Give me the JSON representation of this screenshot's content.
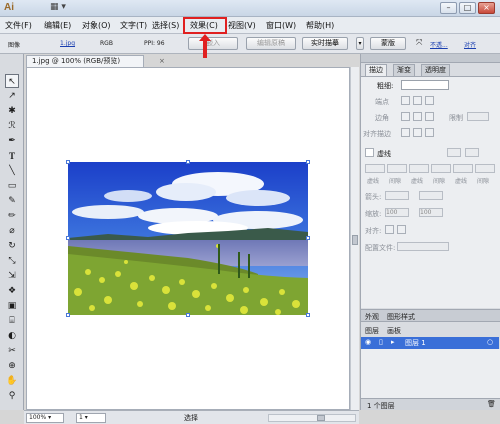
{
  "app": {
    "logo": "Ai",
    "arrange_icon": "▦ ▾"
  },
  "window_controls": [
    "–",
    "□",
    "×"
  ],
  "menu": [
    {
      "label": "文件(F)"
    },
    {
      "label": "编辑(E)"
    },
    {
      "label": "对象(O)"
    },
    {
      "label": "文字(T)"
    },
    {
      "label": "选择(S)"
    },
    {
      "label": "效果(C)"
    },
    {
      "label": "视图(V)"
    },
    {
      "label": "窗口(W)"
    },
    {
      "label": "帮助(H)"
    }
  ],
  "control_bar": {
    "object_type": "图像",
    "file_name": "1.jpg",
    "color_mode": "RGB",
    "ppi": "PPI: 96",
    "embed_button": "嵌入",
    "edit_original_button": "编辑原稿",
    "live_trace_button": "实时描摹",
    "mask_button": "蒙版",
    "opacity_link": "不透...",
    "align_link": "对齐"
  },
  "document": {
    "tab_title": "1.jpg @ 100% (RGB/预览)",
    "close": "×"
  },
  "status": {
    "zoom": "100%",
    "page": "1",
    "tool": "选择"
  },
  "tools": [
    {
      "glyph": "↖"
    },
    {
      "glyph": "↗"
    },
    {
      "glyph": "✱"
    },
    {
      "glyph": "ℛ"
    },
    {
      "glyph": "✒"
    },
    {
      "glyph": "T"
    },
    {
      "glyph": "╲"
    },
    {
      "glyph": "▭"
    },
    {
      "glyph": "✎"
    },
    {
      "glyph": "✏"
    },
    {
      "glyph": "⌀"
    },
    {
      "glyph": "↻"
    },
    {
      "glyph": "⤡"
    },
    {
      "glyph": "⇲"
    },
    {
      "glyph": "❖"
    },
    {
      "glyph": "▣"
    },
    {
      "glyph": "⌸"
    },
    {
      "glyph": "◐"
    },
    {
      "glyph": "✂"
    },
    {
      "glyph": "⊕"
    },
    {
      "glyph": "✋"
    },
    {
      "glyph": "⚲"
    }
  ],
  "panel": {
    "tabs": [
      "描边",
      "渐变",
      "透明度"
    ],
    "weight_label": "粗细:",
    "cap_label": "端点",
    "corner_label": "边角",
    "limit_label": "限制",
    "align_stroke_label": "对齐描边",
    "dashed_label": "虚线",
    "dash_fields": [
      "虚线",
      "间隙",
      "虚线",
      "间隙",
      "虚线",
      "间隙"
    ],
    "arrow_label": "箭头:",
    "scale_label": "缩放:",
    "scale_values": [
      "100",
      "100"
    ],
    "align_label": "对齐:",
    "profile_label": "配置文件:",
    "appearance_tabs": [
      "外观",
      "图形样式"
    ],
    "layers_tabs": [
      "图层",
      "画板"
    ],
    "layer_name": "图层 1",
    "layers_count": "1 个图层"
  }
}
